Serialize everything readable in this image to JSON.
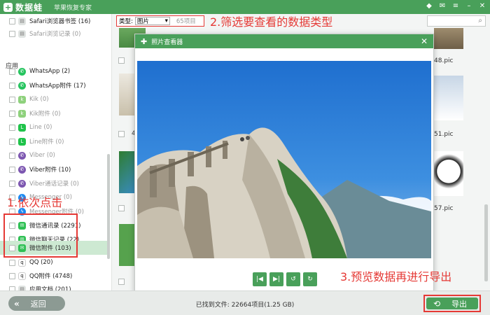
{
  "app": {
    "name": "数据蛙",
    "subtitle": "苹果恢复专家",
    "logo": "+"
  },
  "window_controls": [
    "diamond-icon",
    "mail-icon",
    "menu-icon",
    "minimize-icon",
    "close-icon"
  ],
  "sidebar": {
    "section_label": "应用",
    "items": [
      {
        "label": "Safari浏览器书签 (16)",
        "icon": "file-icon",
        "dim": false
      },
      {
        "label": "Safari浏览记录 (0)",
        "icon": "file-icon",
        "dim": true
      },
      {
        "label": "WhatsApp (2)",
        "icon": "whatsapp-icon",
        "dim": false
      },
      {
        "label": "WhatsApp附件 (17)",
        "icon": "whatsapp-icon",
        "dim": false
      },
      {
        "label": "Kik (0)",
        "icon": "kik-icon",
        "dim": true
      },
      {
        "label": "Kik附件 (0)",
        "icon": "kik-icon",
        "dim": true
      },
      {
        "label": "Line (0)",
        "icon": "line-icon",
        "dim": true
      },
      {
        "label": "Line附件 (0)",
        "icon": "line-icon",
        "dim": true
      },
      {
        "label": "Viber (0)",
        "icon": "viber-icon",
        "dim": true
      },
      {
        "label": "Viber附件 (10)",
        "icon": "viber-icon",
        "dim": false
      },
      {
        "label": "Viber通话记录 (0)",
        "icon": "viber-icon",
        "dim": true
      },
      {
        "label": "Messenger (0)",
        "icon": "messenger-icon",
        "dim": true
      },
      {
        "label": "Messenger附件 (0)",
        "icon": "messenger-icon",
        "dim": true
      },
      {
        "label": "微信通讯录 (2291)",
        "icon": "wechat-icon",
        "dim": false
      },
      {
        "label": "微信聊天记录 (22)",
        "icon": "wechat-icon",
        "dim": false
      },
      {
        "label": "微信附件 (103)",
        "icon": "wechat-icon",
        "dim": false,
        "selected": true
      },
      {
        "label": "QQ (20)",
        "icon": "qq-icon",
        "dim": false
      },
      {
        "label": "QQ附件 (4748)",
        "icon": "qq-icon",
        "dim": false
      },
      {
        "label": "应用文档 (201)",
        "icon": "file-icon",
        "dim": false
      }
    ]
  },
  "filter": {
    "type_label": "类型:",
    "selected": "图片",
    "count": "65项目"
  },
  "annotations": {
    "step1": "1.依次点击",
    "step2": "2.筛选要查看的数据类型",
    "step3": "3.预览数据再进行导出"
  },
  "gallery": {
    "pic_labels": [
      "48.pic",
      "51.pic",
      "57.pic"
    ],
    "side_label": "4"
  },
  "viewer": {
    "title": "照片查看器",
    "controls": [
      "first-icon",
      "last-icon",
      "rotate-left-icon",
      "rotate-right-icon"
    ]
  },
  "footer": {
    "back_label": "返回",
    "found_text": "已找到文件: 22664项目(1.25 GB)",
    "export_label": "导出"
  },
  "colors": {
    "accent": "#49a05a",
    "highlight": "#e53935",
    "selected_row": "#cde9d2"
  }
}
